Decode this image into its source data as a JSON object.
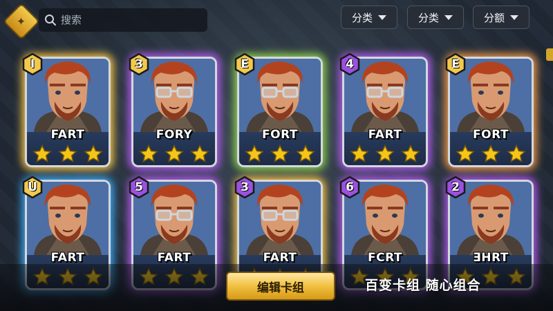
{
  "topbar": {
    "search_placeholder": "搜索",
    "filters": [
      {
        "label": "分类"
      },
      {
        "label": "分类"
      },
      {
        "label": "分额"
      }
    ]
  },
  "cards": [
    {
      "badge": "I",
      "badge_color": "#f2c94c",
      "name": "FART",
      "glasses": false,
      "glow": "gold",
      "stars": 3
    },
    {
      "badge": "3",
      "badge_color": "#f2c94c",
      "name": "FORY",
      "glasses": true,
      "glow": "purple",
      "stars": 3
    },
    {
      "badge": "E",
      "badge_color": "#f2c94c",
      "name": "FORT",
      "glasses": true,
      "glow": "green",
      "stars": 3
    },
    {
      "badge": "4",
      "badge_color": "#9b51e0",
      "name": "FART",
      "glasses": true,
      "glow": "purple",
      "stars": 3
    },
    {
      "badge": "E",
      "badge_color": "#f2c94c",
      "name": "FORT",
      "glasses": false,
      "glow": "orange",
      "stars": 3
    },
    {
      "badge": "ᑌ",
      "badge_color": "#f2c94c",
      "name": "FART",
      "glasses": false,
      "glow": "blue",
      "stars": 3
    },
    {
      "badge": "5",
      "badge_color": "#9b51e0",
      "name": "FART",
      "glasses": true,
      "glow": "purple",
      "stars": 3
    },
    {
      "badge": "3",
      "badge_color": "#9b51e0",
      "name": "FART",
      "glasses": true,
      "glow": "gold",
      "stars": 3
    },
    {
      "badge": "6",
      "badge_color": "#9b51e0",
      "name": "FCRT",
      "glasses": false,
      "glow": "purple",
      "stars": 3
    },
    {
      "badge": "2",
      "badge_color": "#9b51e0",
      "name": "ƎHRT",
      "glasses": false,
      "glow": "purple",
      "stars": 3
    }
  ],
  "bottom": {
    "edit_button": "编辑卡组",
    "slogan": "百变卡组 随心组合"
  },
  "colors": {
    "gold": "#f6c344",
    "purple": "#b25cf0",
    "green": "#8fd44a",
    "orange": "#f2994a",
    "blue": "#3fa9f5"
  }
}
